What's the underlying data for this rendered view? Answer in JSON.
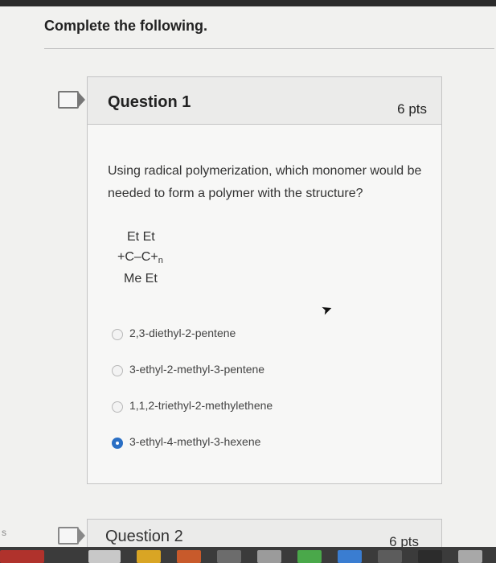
{
  "page": {
    "title": "Complete the following."
  },
  "question1": {
    "title": "Question 1",
    "points": "6 pts",
    "prompt": "Using radical polymerization, which monomer would be needed to form a polymer with the structure?",
    "structure": {
      "row1": "Et  Et",
      "row2": "+C–C+",
      "row2_sub": "n",
      "row3": "Me  Et"
    },
    "choices": [
      {
        "label": "2,3-diethyl-2-pentene",
        "selected": false
      },
      {
        "label": "3-ethyl-2-methyl-3-pentene",
        "selected": false
      },
      {
        "label": "1,1,2-triethyl-2-methylethene",
        "selected": false
      },
      {
        "label": "3-ethyl-4-methyl-3-hexene",
        "selected": true
      }
    ]
  },
  "question2": {
    "title": "Question 2",
    "points": "6 pts"
  },
  "edge_letter": "s",
  "colors": {
    "accent": "#2a6fc4",
    "card_bg": "#f7f7f6",
    "header_bg": "#ebebea",
    "taskbar": "#3b3b3b"
  }
}
